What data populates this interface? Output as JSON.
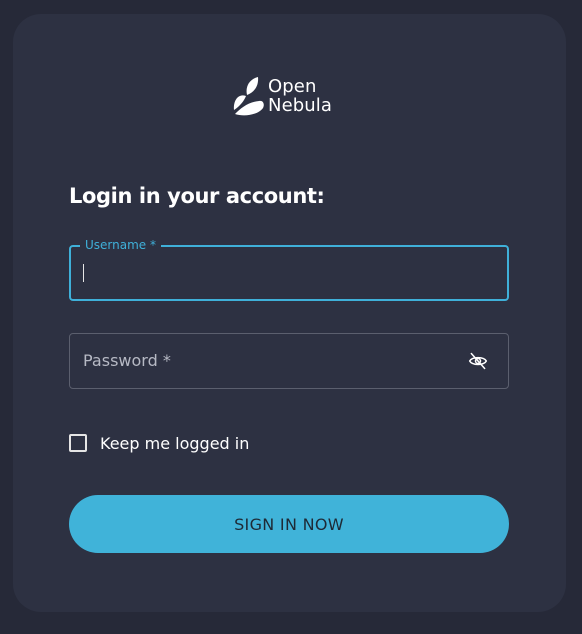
{
  "brand": {
    "line1": "Open",
    "line2": "Nebula",
    "icon": "opennebula-logo-icon"
  },
  "heading": "Login in your account:",
  "form": {
    "username": {
      "label": "Username *",
      "value": ""
    },
    "password": {
      "placeholder": "Password *",
      "value": "",
      "toggle_icon": "eye-slash-icon"
    },
    "remember": {
      "label": "Keep me logged in",
      "checked": false
    },
    "submit_label": "SIGN IN NOW"
  },
  "colors": {
    "page_bg": "#262938",
    "card_bg": "#2d3142",
    "accent": "#40b3d9",
    "text": "#ffffff",
    "placeholder": "#b6b9c4",
    "border": "#5b5f6e"
  }
}
